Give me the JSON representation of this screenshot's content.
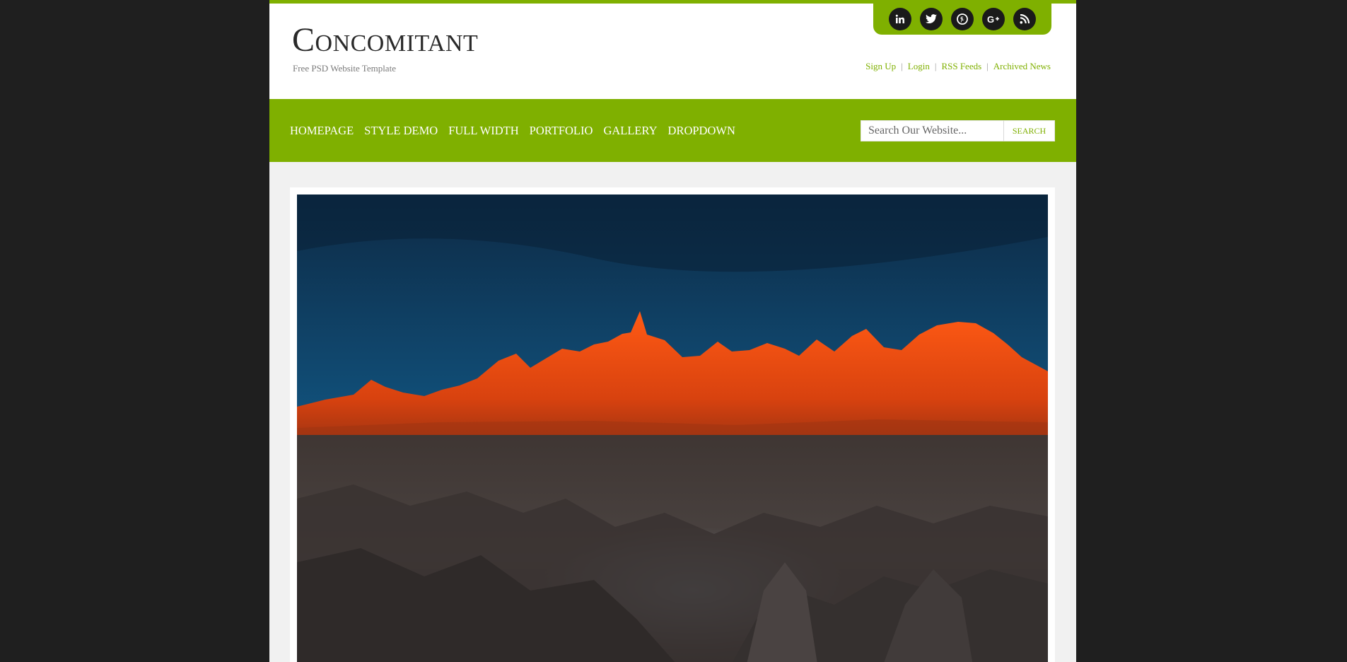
{
  "header": {
    "site_title": "Concomitant",
    "tagline": "Free PSD Website Template",
    "social": [
      {
        "icon": "linkedin-icon",
        "label": "in"
      },
      {
        "icon": "twitter-icon",
        "label": ""
      },
      {
        "icon": "pinterest-icon",
        "label": ""
      },
      {
        "icon": "google-plus-icon",
        "label": "G+"
      },
      {
        "icon": "rss-icon",
        "label": ""
      }
    ],
    "top_links": [
      "Sign Up",
      "Login",
      "RSS Feeds",
      "Archived News"
    ]
  },
  "nav": {
    "items": [
      "HOMEPAGE",
      "STYLE DEMO",
      "FULL WIDTH",
      "PORTFOLIO",
      "GALLERY",
      "DROPDOWN"
    ],
    "search_placeholder": "Search Our Website...",
    "search_button": "SEARCH"
  },
  "colors": {
    "accent": "#7fb000",
    "page_bg": "#1f1f1f",
    "content_bg": "#f1f1f1"
  }
}
